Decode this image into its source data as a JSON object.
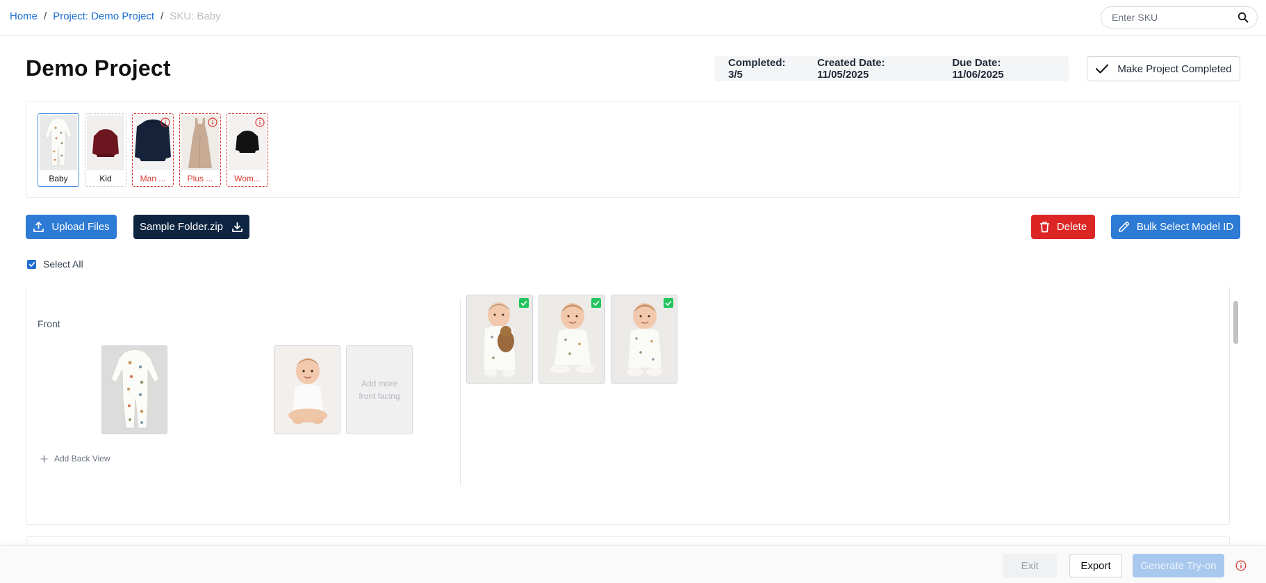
{
  "breadcrumb": {
    "home": "Home",
    "project": "Project: Demo Project",
    "current": "SKU: Baby",
    "separator": "/"
  },
  "search": {
    "placeholder": "Enter SKU",
    "value": ""
  },
  "header": {
    "title": "Demo Project",
    "completed": "Completed: 3/5",
    "created": "Created Date: 11/05/2025",
    "due": "Due Date: 11/06/2025",
    "complete_button": "Make Project Completed"
  },
  "skus": [
    {
      "label": "Baby",
      "state": "selected"
    },
    {
      "label": "Kid",
      "state": "normal"
    },
    {
      "label": "Man ...",
      "state": "error"
    },
    {
      "label": "Plus ...",
      "state": "error"
    },
    {
      "label": "Wom...",
      "state": "error"
    }
  ],
  "actions": {
    "upload": "Upload Files",
    "sample": "Sample Folder.zip",
    "delete": "Delete",
    "bulk": "Bulk Select Model ID"
  },
  "select_all": {
    "label": "Select All",
    "checked": true
  },
  "view": {
    "front_label": "Front",
    "add_more": "Add more front facing",
    "add_back": "Add Back View"
  },
  "results_selected": [
    true,
    true,
    true
  ],
  "footer": {
    "exit": "Exit",
    "export": "Export",
    "generate": "Generate Try-on"
  },
  "colors": {
    "primary": "#2d7bd4",
    "dark": "#0e2541",
    "danger": "#dc2626",
    "success": "#22c55e",
    "link": "#1f6fd1"
  }
}
